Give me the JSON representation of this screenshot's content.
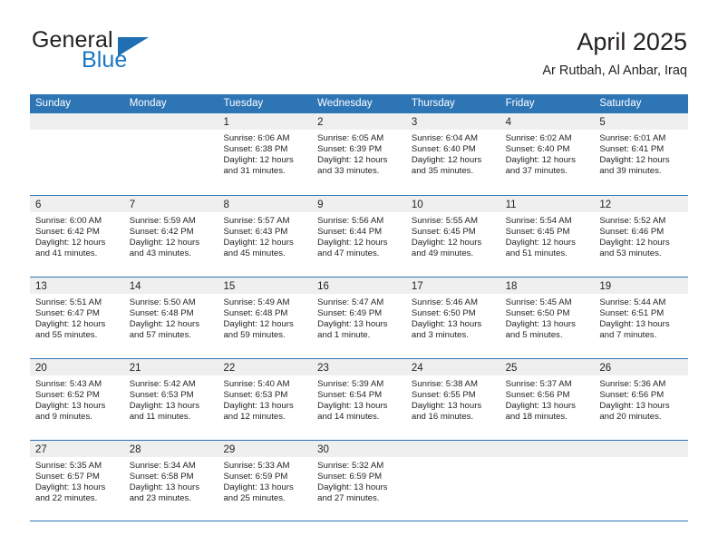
{
  "brand": {
    "name_part1": "General",
    "name_part2": "Blue",
    "mark": "triangle-logo"
  },
  "header": {
    "title": "April 2025",
    "subtitle": "Ar Rutbah, Al Anbar, Iraq"
  },
  "colors": {
    "header_blue": "#2E75B6",
    "brand_blue": "#1B77C4",
    "daynum_band": "#EFEFEF",
    "text": "#231F20"
  },
  "calendar": {
    "weekday_headers": [
      "Sunday",
      "Monday",
      "Tuesday",
      "Wednesday",
      "Thursday",
      "Friday",
      "Saturday"
    ],
    "weeks": [
      [
        {
          "day": "",
          "lines": []
        },
        {
          "day": "",
          "lines": []
        },
        {
          "day": "1",
          "lines": [
            "Sunrise: 6:06 AM",
            "Sunset: 6:38 PM",
            "Daylight: 12 hours",
            "and 31 minutes."
          ]
        },
        {
          "day": "2",
          "lines": [
            "Sunrise: 6:05 AM",
            "Sunset: 6:39 PM",
            "Daylight: 12 hours",
            "and 33 minutes."
          ]
        },
        {
          "day": "3",
          "lines": [
            "Sunrise: 6:04 AM",
            "Sunset: 6:40 PM",
            "Daylight: 12 hours",
            "and 35 minutes."
          ]
        },
        {
          "day": "4",
          "lines": [
            "Sunrise: 6:02 AM",
            "Sunset: 6:40 PM",
            "Daylight: 12 hours",
            "and 37 minutes."
          ]
        },
        {
          "day": "5",
          "lines": [
            "Sunrise: 6:01 AM",
            "Sunset: 6:41 PM",
            "Daylight: 12 hours",
            "and 39 minutes."
          ]
        }
      ],
      [
        {
          "day": "6",
          "lines": [
            "Sunrise: 6:00 AM",
            "Sunset: 6:42 PM",
            "Daylight: 12 hours",
            "and 41 minutes."
          ]
        },
        {
          "day": "7",
          "lines": [
            "Sunrise: 5:59 AM",
            "Sunset: 6:42 PM",
            "Daylight: 12 hours",
            "and 43 minutes."
          ]
        },
        {
          "day": "8",
          "lines": [
            "Sunrise: 5:57 AM",
            "Sunset: 6:43 PM",
            "Daylight: 12 hours",
            "and 45 minutes."
          ]
        },
        {
          "day": "9",
          "lines": [
            "Sunrise: 5:56 AM",
            "Sunset: 6:44 PM",
            "Daylight: 12 hours",
            "and 47 minutes."
          ]
        },
        {
          "day": "10",
          "lines": [
            "Sunrise: 5:55 AM",
            "Sunset: 6:45 PM",
            "Daylight: 12 hours",
            "and 49 minutes."
          ]
        },
        {
          "day": "11",
          "lines": [
            "Sunrise: 5:54 AM",
            "Sunset: 6:45 PM",
            "Daylight: 12 hours",
            "and 51 minutes."
          ]
        },
        {
          "day": "12",
          "lines": [
            "Sunrise: 5:52 AM",
            "Sunset: 6:46 PM",
            "Daylight: 12 hours",
            "and 53 minutes."
          ]
        }
      ],
      [
        {
          "day": "13",
          "lines": [
            "Sunrise: 5:51 AM",
            "Sunset: 6:47 PM",
            "Daylight: 12 hours",
            "and 55 minutes."
          ]
        },
        {
          "day": "14",
          "lines": [
            "Sunrise: 5:50 AM",
            "Sunset: 6:48 PM",
            "Daylight: 12 hours",
            "and 57 minutes."
          ]
        },
        {
          "day": "15",
          "lines": [
            "Sunrise: 5:49 AM",
            "Sunset: 6:48 PM",
            "Daylight: 12 hours",
            "and 59 minutes."
          ]
        },
        {
          "day": "16",
          "lines": [
            "Sunrise: 5:47 AM",
            "Sunset: 6:49 PM",
            "Daylight: 13 hours",
            "and 1 minute."
          ]
        },
        {
          "day": "17",
          "lines": [
            "Sunrise: 5:46 AM",
            "Sunset: 6:50 PM",
            "Daylight: 13 hours",
            "and 3 minutes."
          ]
        },
        {
          "day": "18",
          "lines": [
            "Sunrise: 5:45 AM",
            "Sunset: 6:50 PM",
            "Daylight: 13 hours",
            "and 5 minutes."
          ]
        },
        {
          "day": "19",
          "lines": [
            "Sunrise: 5:44 AM",
            "Sunset: 6:51 PM",
            "Daylight: 13 hours",
            "and 7 minutes."
          ]
        }
      ],
      [
        {
          "day": "20",
          "lines": [
            "Sunrise: 5:43 AM",
            "Sunset: 6:52 PM",
            "Daylight: 13 hours",
            "and 9 minutes."
          ]
        },
        {
          "day": "21",
          "lines": [
            "Sunrise: 5:42 AM",
            "Sunset: 6:53 PM",
            "Daylight: 13 hours",
            "and 11 minutes."
          ]
        },
        {
          "day": "22",
          "lines": [
            "Sunrise: 5:40 AM",
            "Sunset: 6:53 PM",
            "Daylight: 13 hours",
            "and 12 minutes."
          ]
        },
        {
          "day": "23",
          "lines": [
            "Sunrise: 5:39 AM",
            "Sunset: 6:54 PM",
            "Daylight: 13 hours",
            "and 14 minutes."
          ]
        },
        {
          "day": "24",
          "lines": [
            "Sunrise: 5:38 AM",
            "Sunset: 6:55 PM",
            "Daylight: 13 hours",
            "and 16 minutes."
          ]
        },
        {
          "day": "25",
          "lines": [
            "Sunrise: 5:37 AM",
            "Sunset: 6:56 PM",
            "Daylight: 13 hours",
            "and 18 minutes."
          ]
        },
        {
          "day": "26",
          "lines": [
            "Sunrise: 5:36 AM",
            "Sunset: 6:56 PM",
            "Daylight: 13 hours",
            "and 20 minutes."
          ]
        }
      ],
      [
        {
          "day": "27",
          "lines": [
            "Sunrise: 5:35 AM",
            "Sunset: 6:57 PM",
            "Daylight: 13 hours",
            "and 22 minutes."
          ]
        },
        {
          "day": "28",
          "lines": [
            "Sunrise: 5:34 AM",
            "Sunset: 6:58 PM",
            "Daylight: 13 hours",
            "and 23 minutes."
          ]
        },
        {
          "day": "29",
          "lines": [
            "Sunrise: 5:33 AM",
            "Sunset: 6:59 PM",
            "Daylight: 13 hours",
            "and 25 minutes."
          ]
        },
        {
          "day": "30",
          "lines": [
            "Sunrise: 5:32 AM",
            "Sunset: 6:59 PM",
            "Daylight: 13 hours",
            "and 27 minutes."
          ]
        },
        {
          "day": "",
          "lines": []
        },
        {
          "day": "",
          "lines": []
        },
        {
          "day": "",
          "lines": []
        }
      ]
    ]
  }
}
